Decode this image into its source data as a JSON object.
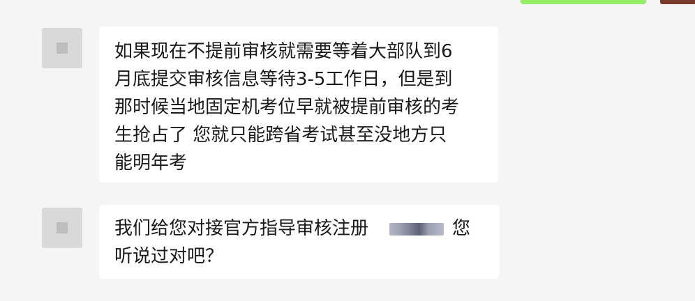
{
  "messages": [
    {
      "lines": [
        "如果现在不提前审核就需要等着大部队到6",
        "月底提交审核信息等待3-5工作日，但是到",
        "那时候当地固定机考位早就被提前审核的考",
        "生抢占了  您就只能跨省考试甚至没地方只",
        "能明年考"
      ]
    },
    {
      "line1_before": "我们给您对接官方指导审核注册",
      "line1_after": "您",
      "line2": "听说过对吧？"
    }
  ]
}
